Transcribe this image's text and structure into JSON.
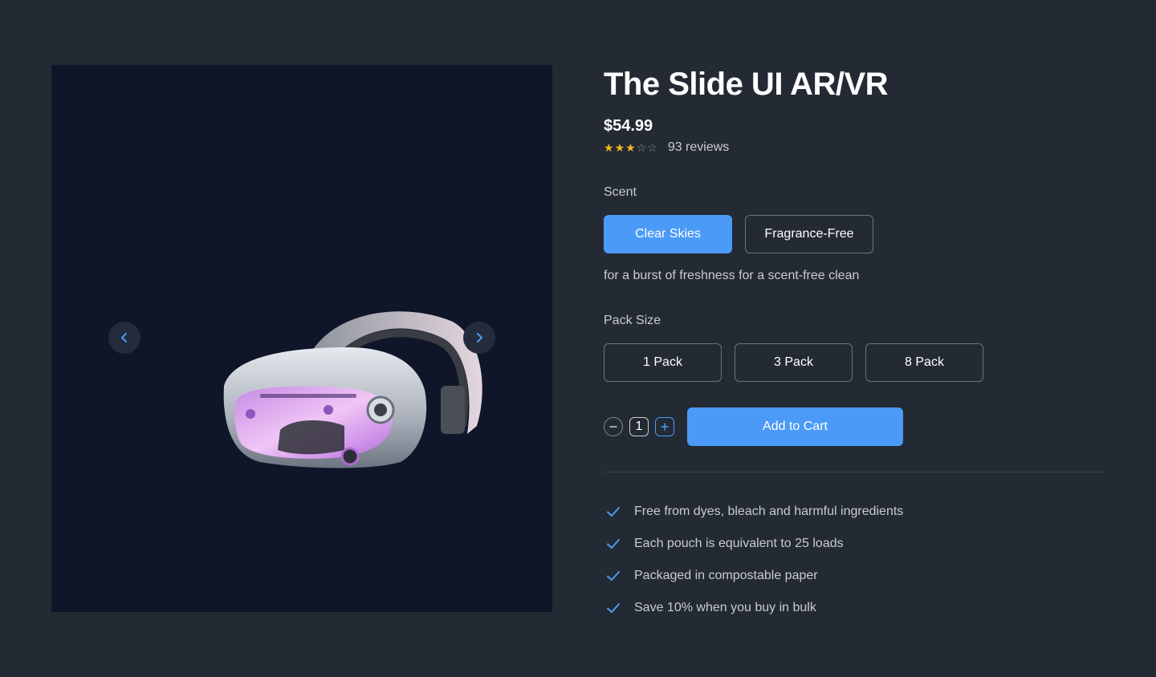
{
  "product": {
    "title": "The Slide UI AR/VR",
    "price": "$54.99",
    "rating": 3,
    "rating_max": 5,
    "reviews": "93 reviews"
  },
  "gallery": {
    "image": "vr-headset-image",
    "prev_icon": "chevron-left-icon",
    "next_icon": "chevron-right-icon"
  },
  "scent": {
    "label": "Scent",
    "options": [
      "Clear Skies",
      "Fragrance-Free"
    ],
    "selected": "Clear Skies",
    "description": "for a burst of freshness for a scent-free clean"
  },
  "pack": {
    "label": "Pack Size",
    "options": [
      "1 Pack",
      "3 Pack",
      "8 Pack"
    ]
  },
  "quantity": {
    "value": "1"
  },
  "cart": {
    "label": "Add to Cart"
  },
  "features": [
    "Free from dyes, bleach and harmful ingredients",
    "Each pouch is equivalent to 25 loads",
    "Packaged in compostable paper",
    "Save 10% when you buy in bulk"
  ],
  "colors": {
    "background": "#232a33",
    "gallery": "#0f1629",
    "accent": "#4b9af7",
    "star": "#f5b81e"
  }
}
